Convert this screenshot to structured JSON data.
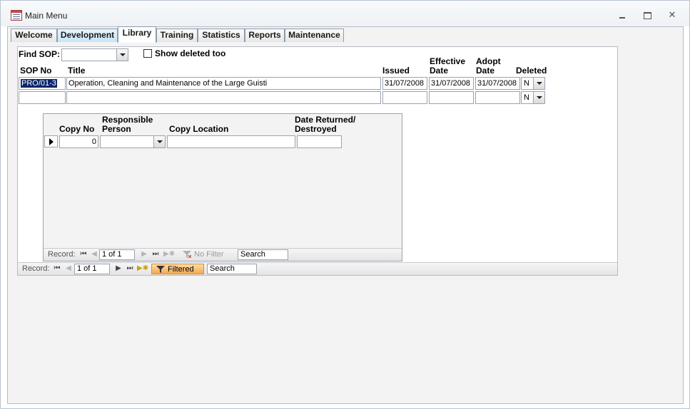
{
  "window": {
    "title": "Main Menu",
    "controls": [
      "minimize",
      "restore",
      "close"
    ]
  },
  "tabs": [
    {
      "label": "Welcome"
    },
    {
      "label": "Development"
    },
    {
      "label": "Library"
    },
    {
      "label": "Training"
    },
    {
      "label": "Statistics"
    },
    {
      "label": "Reports"
    },
    {
      "label": "Maintenance"
    }
  ],
  "active_tab": "Library",
  "find_sop": {
    "label": "Find SOP:",
    "value": ""
  },
  "show_deleted": {
    "label": "Show deleted too",
    "checked": false
  },
  "columns": {
    "sop_no": "SOP No",
    "title": "Title",
    "issued": "Issued",
    "effective_1": "Effective",
    "effective_2": "Date",
    "adopt_1": "Adopt",
    "adopt_2": "Date",
    "deleted": "Deleted"
  },
  "records": [
    {
      "sop_no": "PRO/01-3",
      "title": "Operation, Cleaning and Maintenance of the Large Guisti",
      "issued": "31/07/2008",
      "effective": "31/07/2008",
      "adopt": "31/07/2008",
      "deleted": "N"
    },
    {
      "sop_no": "",
      "title": "",
      "issued": "",
      "effective": "",
      "adopt": "",
      "deleted": "N"
    }
  ],
  "subform": {
    "columns": {
      "copy_no": "Copy No",
      "responsible_1": "Responsible",
      "responsible_2": "Person",
      "copy_location": "Copy Location",
      "date_returned_1": "Date Returned/",
      "date_returned_2": "Destroyed"
    },
    "row": {
      "copy_no": "0",
      "responsible": "",
      "copy_location": "",
      "date_returned": ""
    },
    "nav": {
      "label": "Record:",
      "position": "1 of 1",
      "filter": "No Filter",
      "search": "Search"
    }
  },
  "main_nav": {
    "label": "Record:",
    "position": "1 of 1",
    "filter": "Filtered",
    "search": "Search"
  },
  "colors": {
    "filtered_badge": "#f5a84c",
    "active_tab_bg": "#ffffff",
    "dev_tab_bg": "#c7e4f6"
  }
}
